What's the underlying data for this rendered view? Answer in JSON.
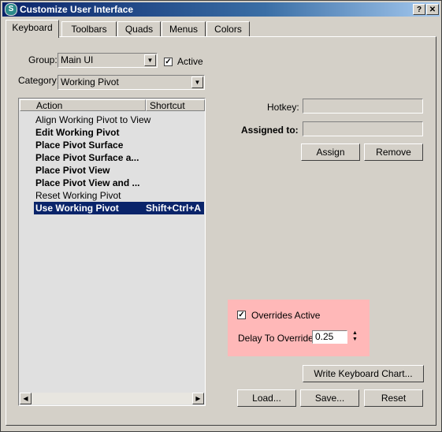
{
  "window": {
    "title": "Customize User Interface",
    "help_label": "?",
    "close_label": "✕"
  },
  "tabs": [
    {
      "label": "Keyboard",
      "active": true
    },
    {
      "label": "Toolbars"
    },
    {
      "label": "Quads"
    },
    {
      "label": "Menus"
    },
    {
      "label": "Colors"
    }
  ],
  "group": {
    "label": "Group:",
    "value": "Main UI"
  },
  "active": {
    "label": "Active",
    "checked": true
  },
  "category": {
    "label": "Category:",
    "value": "Working Pivot"
  },
  "list": {
    "headers": {
      "action": "Action",
      "shortcut": "Shortcut"
    },
    "rows": [
      {
        "action": "Align Working Pivot to View",
        "shortcut": ""
      },
      {
        "action": "Edit Working Pivot",
        "shortcut": ""
      },
      {
        "action": "Place Pivot Surface",
        "shortcut": ""
      },
      {
        "action": "Place Pivot Surface a...",
        "shortcut": ""
      },
      {
        "action": "Place Pivot View",
        "shortcut": ""
      },
      {
        "action": "Place Pivot View and ...",
        "shortcut": ""
      },
      {
        "action": "Reset Working Pivot",
        "shortcut": ""
      },
      {
        "action": "Use Working Pivot",
        "shortcut": "Shift+Ctrl+A"
      }
    ]
  },
  "hotkey": {
    "label": "Hotkey:",
    "value": ""
  },
  "assigned": {
    "label": "Assigned to:",
    "value": ""
  },
  "buttons": {
    "assign": "Assign",
    "remove": "Remove",
    "write_chart": "Write Keyboard Chart...",
    "load": "Load...",
    "save": "Save...",
    "reset": "Reset"
  },
  "overrides": {
    "label": "Overrides Active",
    "checked": true
  },
  "delay": {
    "label": "Delay To Override:",
    "value": "0.25"
  },
  "icons": {
    "app": "3dsmax-logo-icon",
    "dropdown": "down-triangle-icon",
    "checkbox": "checkmark-icon",
    "scroll_left": "left-triangle-icon",
    "scroll_right": "right-triangle-icon",
    "spinner": "up-down-spinner-icon"
  },
  "colors": {
    "titlebar_start": "#0a246a",
    "selection": "#0a246a",
    "override_bg": "#ffb8b8",
    "dialog_bg": "#d4d0c8"
  }
}
